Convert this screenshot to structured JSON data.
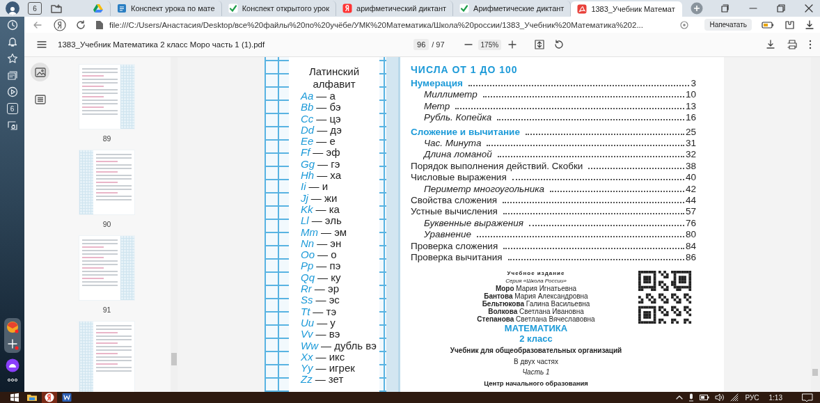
{
  "tab_strip": {
    "tab_count": "6",
    "tabs": [
      {
        "kind": "drive",
        "selected": false
      },
      {
        "kind": "doc",
        "title": "Конспект урока по мате",
        "selected": false
      },
      {
        "kind": "check",
        "title": "Конспект открытого урок",
        "selected": false
      },
      {
        "kind": "yandex",
        "title": "арифметический диктант",
        "selected": false
      },
      {
        "kind": "check",
        "title": "Арифметические диктант",
        "selected": false
      },
      {
        "kind": "pdf",
        "title": "1383_Учебник Математ",
        "selected": true
      }
    ]
  },
  "browser_sidebar": {
    "badge": "6"
  },
  "address_bar": {
    "url": "file:///C:/Users/Анастасия/Desktop/все%20файлы%20по%20учёбе/УМК%20Математика/Школа%20россии/1383_Учебник%20Математика%202...",
    "print_button": "Напечатать"
  },
  "pdf_toolbar": {
    "file_name": "1383_Учебник Математика 2 класс Моро часть 1 (1).pdf",
    "page": "96",
    "page_total": "/ 97",
    "zoom": "175%"
  },
  "thumbnail_panel": {
    "view_buttons": [
      {
        "kind": "thumbnails",
        "selected": true
      },
      {
        "kind": "outline",
        "selected": false
      }
    ],
    "thumbnails": [
      {
        "label": "89",
        "cut_off": false
      },
      {
        "label": "90",
        "cut_off": false
      },
      {
        "label": "91",
        "cut_off": false
      },
      {
        "cut_off": true
      }
    ]
  },
  "page": {
    "alphabet": {
      "title_lines": [
        "Латинский",
        "алфавит"
      ],
      "letters": [
        {
          "letters": "Aa",
          "sound": "— а"
        },
        {
          "letters": "Bb",
          "sound": "— бэ"
        },
        {
          "letters": "Cc",
          "sound": "— цэ"
        },
        {
          "letters": "Dd",
          "sound": "— дэ"
        },
        {
          "letters": "Ee",
          "sound": "— е"
        },
        {
          "letters": "Ff",
          "sound": "— эф"
        },
        {
          "letters": "Gg",
          "sound": "— гэ"
        },
        {
          "letters": "Hh",
          "sound": "— ха"
        },
        {
          "letters": "Ii",
          "sound": "— и"
        },
        {
          "letters": "Jj",
          "sound": "— жи"
        },
        {
          "letters": "Kk",
          "sound": "— ка"
        },
        {
          "letters": "Ll",
          "sound": "— эль"
        },
        {
          "letters": "Mm",
          "sound": "— эм"
        },
        {
          "letters": "Nn",
          "sound": "— эн"
        },
        {
          "letters": "Oo",
          "sound": "— о"
        },
        {
          "letters": "Pp",
          "sound": "— пэ"
        },
        {
          "letters": "Qq",
          "sound": "— ку"
        },
        {
          "letters": "Rr",
          "sound": "— эр"
        },
        {
          "letters": "Ss",
          "sound": "— эс"
        },
        {
          "letters": "Tt",
          "sound": "— тэ"
        },
        {
          "letters": "Uu",
          "sound": "— у"
        },
        {
          "letters": "Vv",
          "sound": "— вэ"
        },
        {
          "letters": "Ww",
          "sound": "— дубль вэ"
        },
        {
          "letters": "Xx",
          "sound": "— икс"
        },
        {
          "letters": "Yy",
          "sound": "— игрек"
        },
        {
          "letters": "Zz",
          "sound": "— зет"
        }
      ]
    },
    "contents": {
      "title": "ЧИСЛА ОТ 1 ДО 100",
      "entries": [
        {
          "kind": "section",
          "title": "Нумерация",
          "page": "3"
        },
        {
          "kind": "subtopic",
          "title": "Миллиметр",
          "page": "10"
        },
        {
          "kind": "subtopic",
          "title": "Метр",
          "page": "13"
        },
        {
          "kind": "subtopic",
          "title": "Рубль. Копейка",
          "page": "16"
        },
        {
          "kind": "section",
          "title": "Сложение и вычитание",
          "page": "25"
        },
        {
          "kind": "subtopic",
          "title": "Час. Минута",
          "page": "31"
        },
        {
          "kind": "subtopic",
          "title": "Длина ломаной",
          "page": "32"
        },
        {
          "kind": "topic",
          "title": "Порядок выполнения действий. Скобки",
          "page": "38"
        },
        {
          "kind": "topic",
          "title": "Числовые выражения",
          "page": "40"
        },
        {
          "kind": "subtopic",
          "title": "Периметр многоугольника",
          "page": "42"
        },
        {
          "kind": "topic",
          "title": "Свойства сложения",
          "page": "44"
        },
        {
          "kind": "topic",
          "title": "Устные вычисления",
          "page": "57"
        },
        {
          "kind": "subtopic",
          "title": "Буквенные выражения",
          "page": "76"
        },
        {
          "kind": "subtopic",
          "title": "Уравнение",
          "page": "80"
        },
        {
          "kind": "topic",
          "title": "Проверка сложения",
          "page": "84"
        },
        {
          "kind": "topic",
          "title": "Проверка вычитания",
          "page": "86"
        }
      ]
    },
    "imprint": [
      {
        "kind": "label",
        "text": "Учебное издание"
      },
      {
        "kind": "series",
        "text": "Серия «Школа России»"
      },
      {
        "kind": "author",
        "text": "**Моро** Мария Игнатьевна"
      },
      {
        "kind": "author",
        "text": "**Бантова** Мария Александровна"
      },
      {
        "kind": "author",
        "text": "**Бельтюкова** Галина Васильевна"
      },
      {
        "kind": "author",
        "text": "**Волкова** Светлана Ивановна"
      },
      {
        "kind": "author",
        "text": "**Степанова** Светлана Вячеславовна"
      },
      {
        "kind": "subject",
        "text": "МАТЕМАТИКА"
      },
      {
        "kind": "subject",
        "text": "2 класс"
      },
      {
        "kind": "description",
        "text": "Учебник для общеобразовательных организаций"
      },
      {
        "kind": "parts",
        "text": "В двух частях"
      },
      {
        "kind": "part",
        "text": "Часть 1"
      },
      {
        "kind": "publisher",
        "text": "Центр начального образования"
      }
    ]
  },
  "taskbar": {
    "language": "РУС",
    "time": "1:13"
  }
}
